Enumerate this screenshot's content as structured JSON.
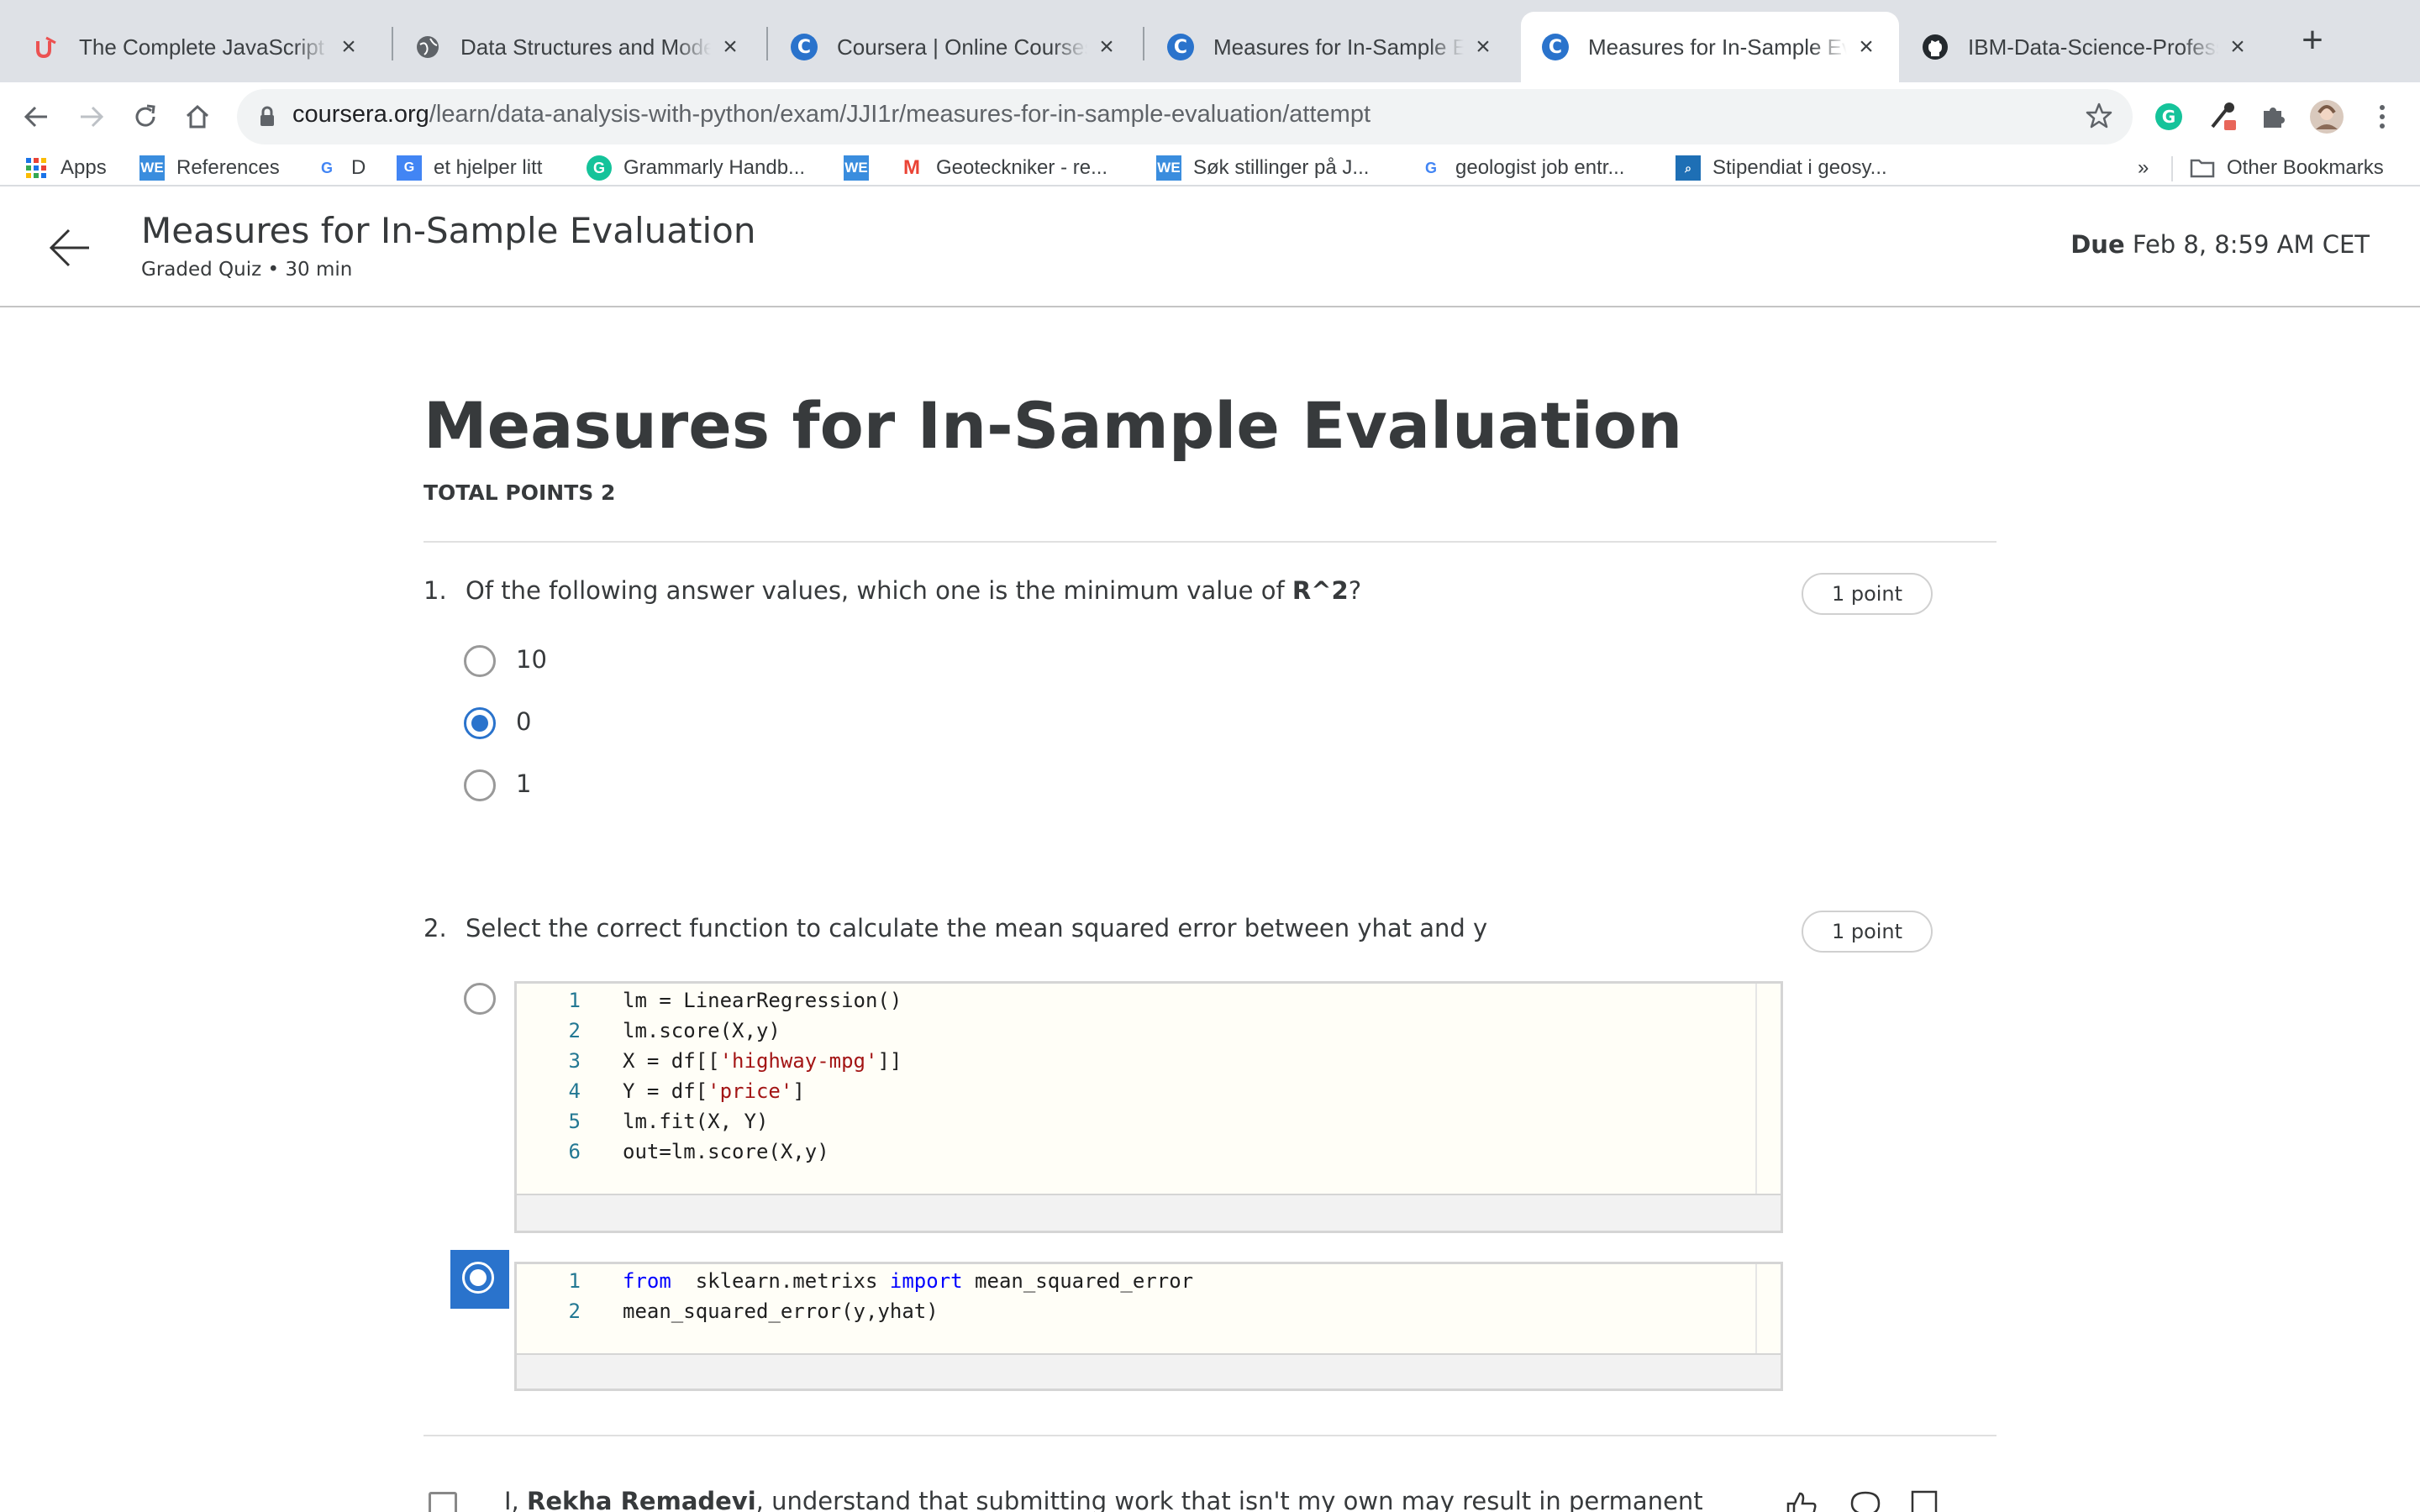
{
  "browser": {
    "tabs": [
      {
        "title": "The Complete JavaScript Co",
        "favicon": "udemy-icon"
      },
      {
        "title": "Data Structures and Modern",
        "favicon": "globe-icon"
      },
      {
        "title": "Coursera | Online Courses &",
        "favicon": "coursera-icon"
      },
      {
        "title": "Measures for In-Sample Eval",
        "favicon": "coursera-icon"
      },
      {
        "title": "Measures for In-Sample Eva",
        "favicon": "coursera-icon"
      },
      {
        "title": "IBM-Data-Science-Professio",
        "favicon": "github-icon"
      }
    ],
    "active_tab": 4,
    "url_host": "coursera.org",
    "url_path": "/learn/data-analysis-with-python/exam/JJI1r/measures-for-in-sample-evaluation/attempt",
    "bookmarks": [
      {
        "label": "Apps",
        "icon": "apps-grid-icon"
      },
      {
        "label": "References",
        "icon": "WE"
      },
      {
        "label": "D",
        "icon": "google-icon"
      },
      {
        "label": "et hjelper litt",
        "icon": "google-translate-icon"
      },
      {
        "label": "Grammarly Handb...",
        "icon": "grammarly-icon"
      },
      {
        "label": "",
        "icon": "WE"
      },
      {
        "label": "Geoteckniker - re...",
        "icon": "gmail-icon"
      },
      {
        "label": "Søk stillinger på J...",
        "icon": "WE"
      },
      {
        "label": "geologist job entr...",
        "icon": "google-icon"
      },
      {
        "label": "Stipendiat i geosy...",
        "icon": "search-site-icon"
      }
    ],
    "overflow": "»",
    "other_bookmarks": "Other Bookmarks"
  },
  "header": {
    "title": "Measures for In-Sample Evaluation",
    "subtitle": "Graded Quiz • 30 min",
    "due_label": "Due",
    "due_value": "Feb 8, 8:59 AM CET"
  },
  "quiz": {
    "title": "Measures for In-Sample Evaluation",
    "total_points": "TOTAL POINTS 2",
    "questions": [
      {
        "number": "1.",
        "text_before": "Of the following answer values, which one is the minimum value of ",
        "text_bold": "R^2",
        "text_after": "?",
        "points": "1 point",
        "options": [
          "10",
          "0",
          "1"
        ],
        "selected": 1
      },
      {
        "number": "2.",
        "text": "Select the correct function to calculate the mean squared error between yhat and y",
        "points": "1 point",
        "selected": 1,
        "options": [
          {
            "lines": [
              {
                "n": "1",
                "code": "lm = LinearRegression()"
              },
              {
                "n": "2",
                "code": "lm.score(X,y)"
              },
              {
                "n": "3",
                "pre": "X = df[[",
                "str": "'highway-mpg'",
                "post": "]]"
              },
              {
                "n": "4",
                "pre": "Y = df[",
                "str": "'price'",
                "post": "]"
              },
              {
                "n": "5",
                "code": "lm.fit(X, Y)"
              },
              {
                "n": "6",
                "code": "out=lm.score(X,y)"
              }
            ]
          },
          {
            "lines": [
              {
                "n": "1",
                "kw1": "from",
                "mid": "  sklearn.metrixs ",
                "kw2": "import",
                "post": " mean_squared_error"
              },
              {
                "n": "2",
                "code": "mean_squared_error(y,yhat)"
              }
            ]
          }
        ]
      }
    ],
    "honor": {
      "prefix": "I, ",
      "name": "Rekha Remadevi",
      "text": ", understand that submitting work that isn't my own may result in permanent"
    }
  },
  "colors": {
    "accent": "#2a73cc",
    "text": "#373a3c",
    "code_keyword": "#0000ff",
    "code_string": "#a31515",
    "line_number": "#237893"
  }
}
